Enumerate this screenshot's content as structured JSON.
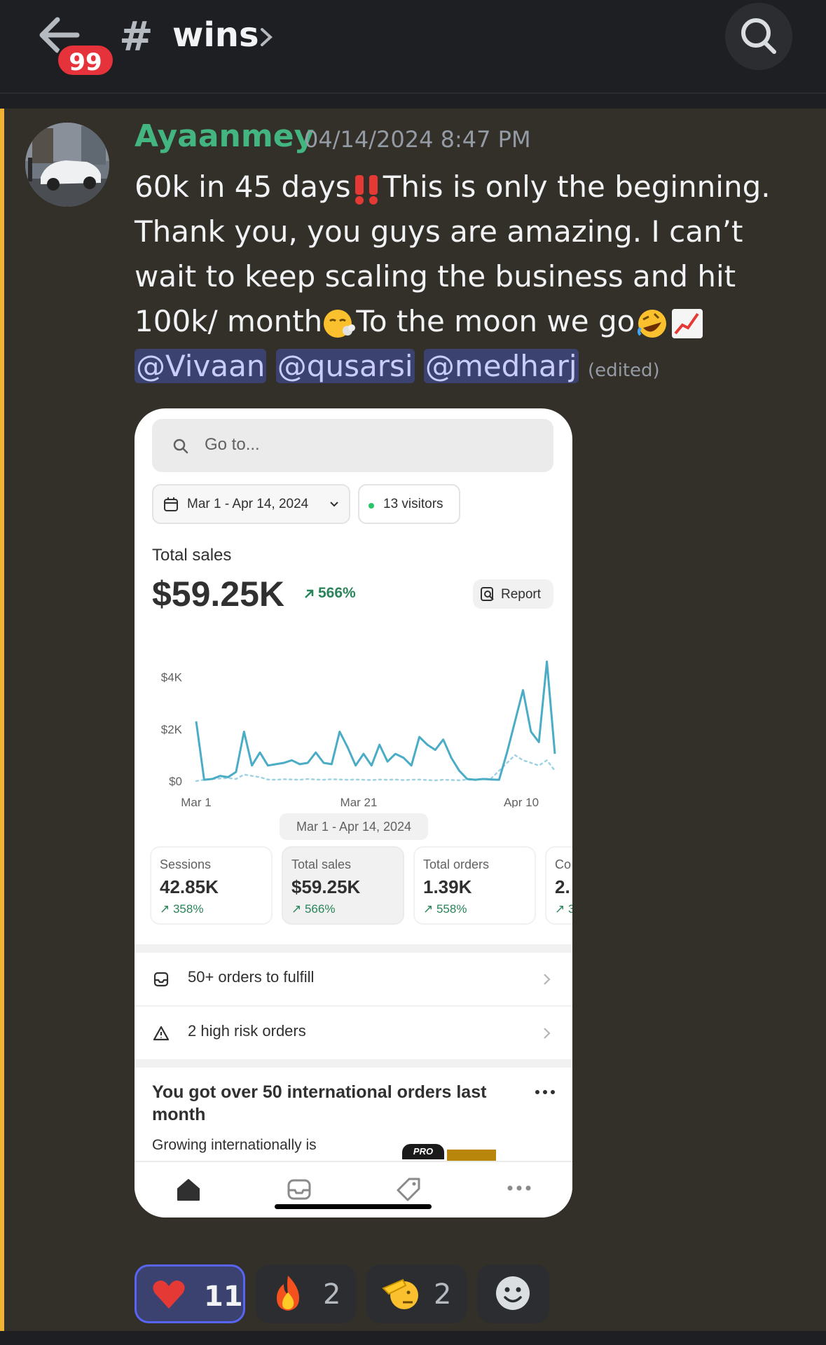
{
  "header": {
    "unread_count": "99",
    "hash": "#",
    "channel_name": "wins"
  },
  "message": {
    "author": "Ayaanmey",
    "timestamp": "04/14/2024 8:47 PM",
    "text_1": "60k in 45 days",
    "text_2": "This is only the beginning. Thank you, you guys are amazing. I can’t wait to keep scaling the business and hit 100k/ month",
    "text_3": "To the moon we go",
    "mentions": [
      "@Vivaan",
      "@qusarsi",
      "@medharj"
    ],
    "edited_label": "(edited)",
    "author_color": "#43b581"
  },
  "screenshot": {
    "search_placeholder": "Go to...",
    "date_range": "Mar 1 - Apr 14, 2024",
    "visitors": "13 visitors",
    "total_sales_label": "Total sales",
    "total_sales_value": "$59.25K",
    "total_sales_change": "566%",
    "report_label": "Report",
    "range_pill": "Mar 1 - Apr 14, 2024",
    "metrics": [
      {
        "label": "Sessions",
        "value": "42.85K",
        "change": "358%"
      },
      {
        "label": "Total sales",
        "value": "$59.25K",
        "change": "566%"
      },
      {
        "label": "Total orders",
        "value": "1.39K",
        "change": "558%"
      },
      {
        "label": "Co",
        "value": "2.",
        "change": "3"
      }
    ],
    "task_rows": [
      "50+ orders to fulfill",
      "2 high risk orders"
    ],
    "card_title": "You got over 50 international orders last month",
    "card_body": "Growing internationally is",
    "pro_label": "PRO",
    "positive_color": "#29845a",
    "line_color": "#4bacc6"
  },
  "chart_data": {
    "type": "line",
    "y_tick_labels": [
      "$4K",
      "$2K",
      "$0"
    ],
    "x_tick_labels": [
      "Mar 1",
      "Mar 21",
      "Apr 10"
    ],
    "ylim": [
      0,
      4800
    ],
    "series": [
      {
        "values": [
          2300,
          50,
          80,
          200,
          150,
          350,
          1900,
          600,
          1100,
          600,
          650,
          700,
          800,
          650,
          700,
          1100,
          700,
          650,
          1900,
          1300,
          600,
          1050,
          600,
          1400,
          750,
          1050,
          900,
          600,
          1700,
          1400,
          1200,
          1600,
          900,
          400,
          80,
          50,
          80,
          60,
          50,
          1100,
          2300,
          3500,
          1900,
          1500,
          4600,
          1050
        ]
      },
      {
        "values": [
          0,
          50,
          80,
          100,
          120,
          80,
          250,
          200,
          150,
          60,
          50,
          70,
          60,
          50,
          80,
          60,
          50,
          70,
          60,
          50,
          60,
          50,
          40,
          60,
          50,
          60,
          40,
          50,
          60,
          40,
          30,
          50,
          40,
          30,
          60,
          40,
          80,
          100,
          400,
          700,
          1000,
          800,
          700,
          600,
          800,
          400
        ]
      }
    ]
  },
  "reactions": [
    {
      "emoji": "heart",
      "count": "11"
    },
    {
      "emoji": "fire",
      "count": "2"
    },
    {
      "emoji": "saluting-face",
      "count": "2"
    }
  ]
}
